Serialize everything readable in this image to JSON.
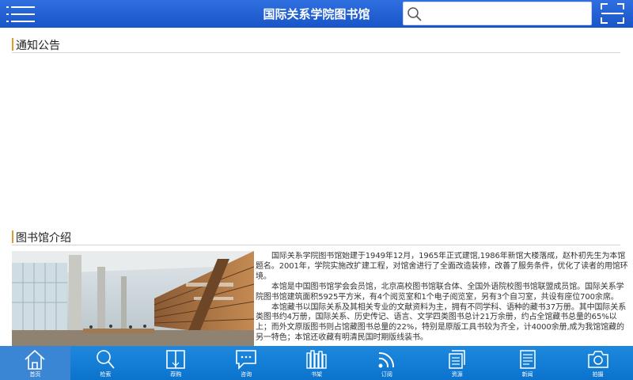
{
  "header": {
    "title": "国际关系学院图书馆",
    "search_value": "",
    "menu_icon": "menu-icon",
    "scan_icon": "scan-icon"
  },
  "sections": {
    "notice_title": "通知公告",
    "intro_title": "图书馆介绍"
  },
  "intro": {
    "paragraphs": [
      "国际关系学院图书馆始建于1949年12月，1965年正式建馆,1986年新馆大楼落成，赵朴初先生为本馆题名。2001年，学院实施改扩建工程，对馆舍进行了全面改造装修，改善了服务条件，优化了读者的用馆环境。",
      "本馆是中国图书馆学会会员馆，北京高校图书馆联合体、全国外语院校图书馆联盟成员馆。国际关系学院图书馆建筑面积5925平方米，有4个阅览室和1个电子阅览室，另有3个自习室，共设有座位700余席。",
      "本馆藏书以国际关系及其相关专业的文献资料为主，拥有不同学科、语种的藏书37万册。其中国际关系类图书约4万册，国际关系、历史传记、语言、文学四类图书总计21万余册，约占全馆藏书总量的65%以上；而外文原版图书则占馆藏图书总量的22%，特别是原版工具书较为齐全，计4000余册,成为我馆馆藏的另一特色；本馆还收藏有明清民国时期版线装书。"
    ]
  },
  "tabs": [
    {
      "label": "首页",
      "icon": "home-icon"
    },
    {
      "label": "检索",
      "icon": "search-icon"
    },
    {
      "label": "荐购",
      "icon": "book-open-icon"
    },
    {
      "label": "咨询",
      "icon": "chat-icon"
    },
    {
      "label": "书架",
      "icon": "bookshelf-icon"
    },
    {
      "label": "订阅",
      "icon": "rss-icon"
    },
    {
      "label": "资源",
      "icon": "resource-icon"
    },
    {
      "label": "新闻",
      "icon": "news-icon"
    },
    {
      "label": "拍摄",
      "icon": "camera-icon"
    }
  ],
  "colors": {
    "header": "#1f5fd6",
    "tabbar": "#0f7ad2",
    "active_tab": "#3b86d4",
    "section_marker": "#e39a2a"
  }
}
